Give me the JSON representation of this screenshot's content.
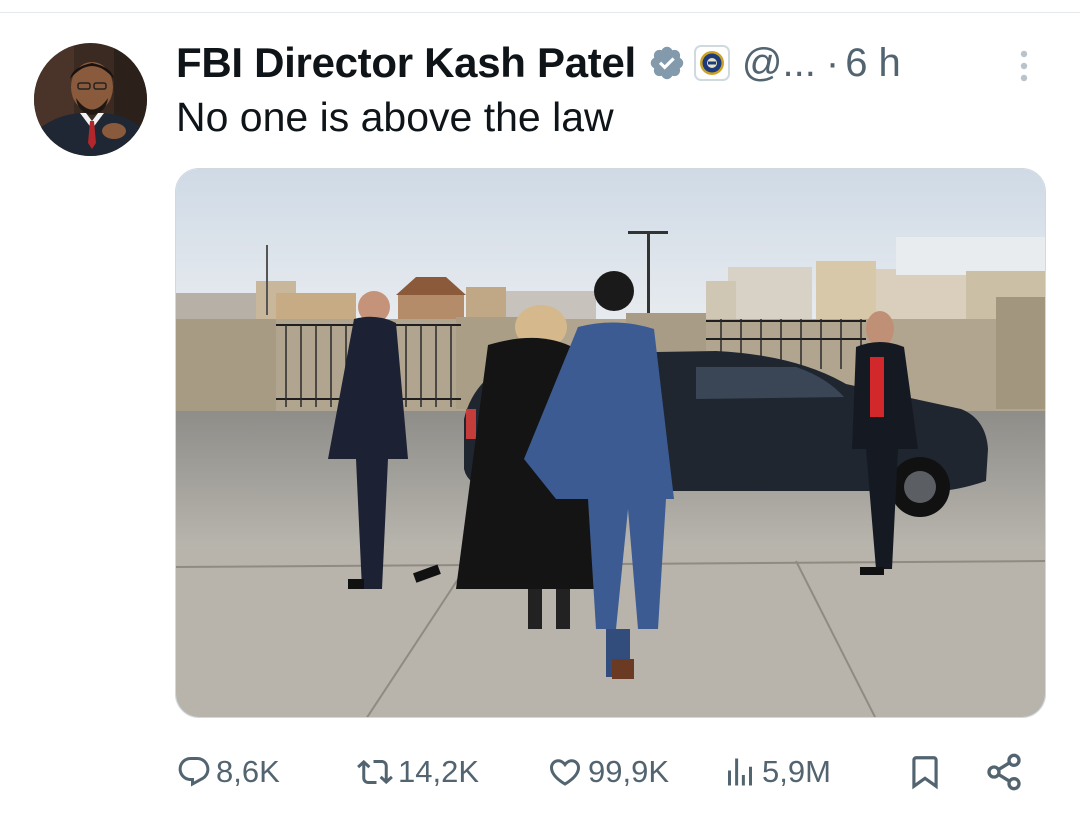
{
  "author": {
    "display_name": "FBI Director Kash Patel",
    "handle": "@...",
    "separator": "·",
    "time": "6 h",
    "verified": true,
    "avatar_icon": "profile-photo",
    "affiliate_icon": "fbi-seal-icon"
  },
  "tweet": {
    "text": "No one is above the law"
  },
  "media": {
    "type": "photo"
  },
  "actions": {
    "replies": "8,6K",
    "reposts": "14,2K",
    "likes": "99,9K",
    "views": "5,9M"
  },
  "colors": {
    "text_primary": "#0f1419",
    "text_secondary": "#536471",
    "verified_badge": "#829aab",
    "border": "#cfd9de"
  }
}
